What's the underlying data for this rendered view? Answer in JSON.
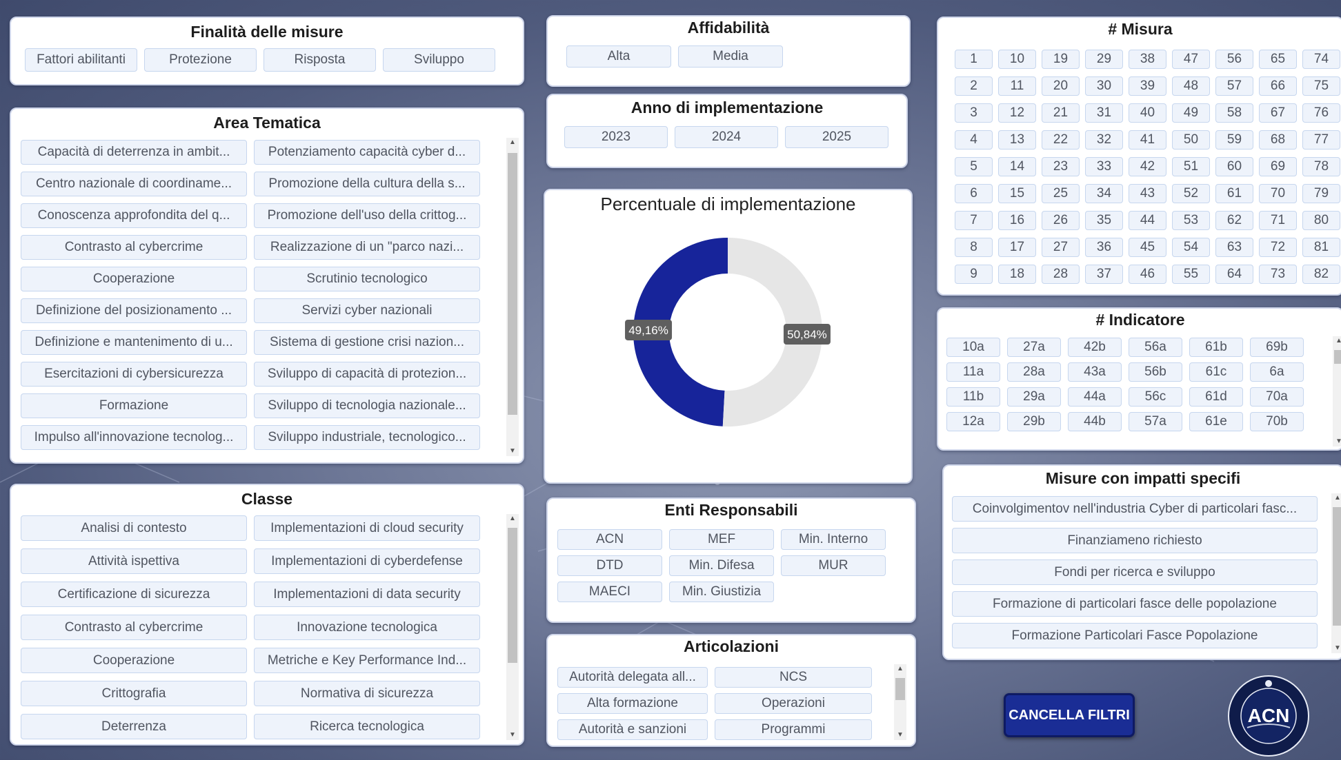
{
  "finalita": {
    "title": "Finalità delle misure",
    "items": [
      "Fattori abilitanti",
      "Protezione",
      "Risposta",
      "Sviluppo"
    ]
  },
  "area": {
    "title": "Area Tematica",
    "items": [
      "Capacità di deterrenza in ambit...",
      "Potenziamento capacità cyber d...",
      "Centro nazionale di coordiname...",
      "Promozione della cultura della s...",
      "Conoscenza approfondita del q...",
      "Promozione dell'uso della crittog...",
      "Contrasto al cybercrime",
      "Realizzazione di un \"parco nazi...",
      "Cooperazione",
      "Scrutinio tecnologico",
      "Definizione del posizionamento ...",
      "Servizi cyber nazionali",
      "Definizione e mantenimento di u...",
      "Sistema di gestione crisi nazion...",
      "Esercitazioni di cybersicurezza",
      "Sviluppo di capacità di protezion...",
      "Formazione",
      "Sviluppo di tecnologia nazionale...",
      "Impulso all'innovazione tecnolog...",
      "Sviluppo industriale, tecnologico..."
    ]
  },
  "classe": {
    "title": "Classe",
    "items": [
      "Analisi di contesto",
      "Implementazioni di cloud security",
      "Attività ispettiva",
      "Implementazioni di cyberdefense",
      "Certificazione di sicurezza",
      "Implementazioni di data security",
      "Contrasto al cybercrime",
      "Innovazione tecnologica",
      "Cooperazione",
      "Metriche e Key Performance Ind...",
      "Crittografia",
      "Normativa di sicurezza",
      "Deterrenza",
      "Ricerca tecnologica"
    ]
  },
  "affidabilita": {
    "title": "Affidabilità",
    "items": [
      "Alta",
      "Media"
    ]
  },
  "anno": {
    "title": "Anno di implementazione",
    "items": [
      "2023",
      "2024",
      "2025"
    ]
  },
  "chart_data": {
    "type": "pie",
    "title": "Percentuale di implementazione",
    "labels": [
      "49,16%",
      "50,84%"
    ],
    "values": [
      49.16,
      50.84
    ],
    "colors": [
      "#17249a",
      "#e6e6e6"
    ]
  },
  "enti": {
    "title": "Enti Responsabili",
    "items": [
      "ACN",
      "MEF",
      "Min. Interno",
      "DTD",
      "Min. Difesa",
      "MUR",
      "MAECI",
      "Min. Giustizia"
    ]
  },
  "articolazioni": {
    "title": "Articolazioni",
    "items": [
      "Autorità delegata all...",
      "NCS",
      "Alta formazione",
      "Operazioni",
      "Autorità e sanzioni",
      "Programmi"
    ]
  },
  "misura": {
    "title": "# Misura",
    "items": [
      "1",
      "10",
      "19",
      "29",
      "38",
      "47",
      "56",
      "65",
      "74",
      "2",
      "11",
      "20",
      "30",
      "39",
      "48",
      "57",
      "66",
      "75",
      "3",
      "12",
      "21",
      "31",
      "40",
      "49",
      "58",
      "67",
      "76",
      "4",
      "13",
      "22",
      "32",
      "41",
      "50",
      "59",
      "68",
      "77",
      "5",
      "14",
      "23",
      "33",
      "42",
      "51",
      "60",
      "69",
      "78",
      "6",
      "15",
      "25",
      "34",
      "43",
      "52",
      "61",
      "70",
      "79",
      "7",
      "16",
      "26",
      "35",
      "44",
      "53",
      "62",
      "71",
      "80",
      "8",
      "17",
      "27",
      "36",
      "45",
      "54",
      "63",
      "72",
      "81",
      "9",
      "18",
      "28",
      "37",
      "46",
      "55",
      "64",
      "73",
      "82"
    ]
  },
  "indicatore": {
    "title": "# Indicatore",
    "items": [
      "10a",
      "27a",
      "42b",
      "56a",
      "61b",
      "69b",
      "11a",
      "28a",
      "43a",
      "56b",
      "61c",
      "6a",
      "11b",
      "29a",
      "44a",
      "56c",
      "61d",
      "70a",
      "12a",
      "29b",
      "44b",
      "57a",
      "61e",
      "70b"
    ]
  },
  "impatti": {
    "title": "Misure con impatti specifi",
    "items": [
      "Coinvolgimentov nell'industria Cyber di particolari fasc...",
      "Finanziameno richiesto",
      "Fondi per ricerca e sviluppo",
      "Formazione di particolari fasce delle popolazione",
      "Formazione Particolari Fasce Popolazione"
    ]
  },
  "actions": {
    "clear_filters": "CANCELLA FILTRI"
  },
  "logo": {
    "text": "ACN"
  }
}
